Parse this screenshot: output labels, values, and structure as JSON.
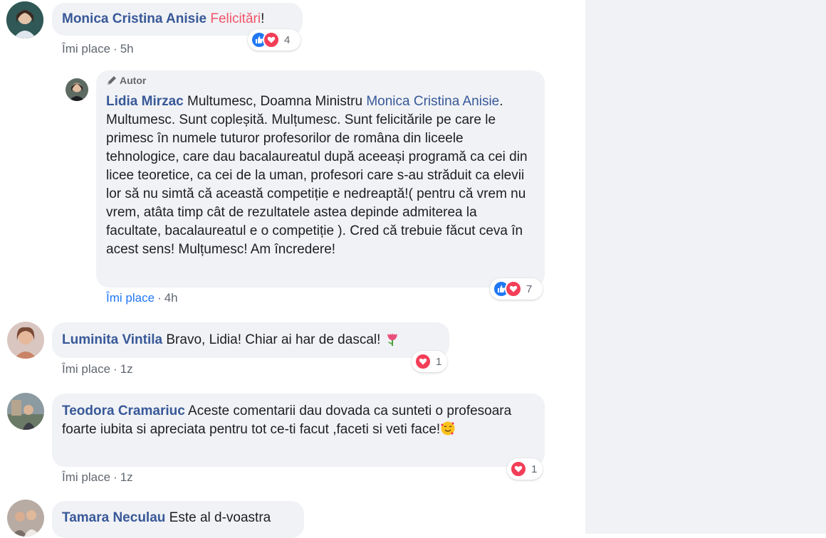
{
  "comments": [
    {
      "name": "Monica Cristina Anisie",
      "text_highlight": "Felicitări",
      "text_suffix": "!",
      "like_label": "Îmi place",
      "time": "5h",
      "reaction_count": "4"
    },
    {
      "badge": "Autor",
      "name": "Lidia Mirzac",
      "text_prefix": " Multumesc, Doamna Ministru ",
      "mention": "Monica Cristina Anisie",
      "text_body": ". Multumesc. Sunt copleșită. Mulțumesc. Sunt felicitările pe care le primesc în numele tuturor profesorilor de româna din liceele tehnologice, care dau bacalaureatul după aceeași programă ca cei din licee teoretice, ca cei de la uman, profesori care s-au străduit ca elevii lor să nu simtă că această competiție e nedreaptă!( pentru că vrem nu vrem, atâta timp cât de rezultatele astea depinde admiterea la facultate, bacalaureatul e o competiție ). Cred că trebuie făcut ceva în acest sens! Mulțumesc! Am încredere!",
      "like_label": "Îmi place",
      "time": "4h",
      "reaction_count": "7"
    },
    {
      "name": "Luminita Vintila",
      "text": " Bravo, Lidia! Chiar ai har de dascal! ",
      "like_label": "Îmi place",
      "time": "1z",
      "reaction_count": "1"
    },
    {
      "name": "Teodora Cramariuc",
      "text": " Aceste comentarii dau dovada ca sunteti o profesoara foarte iubita si apreciata pentru tot ce-ti facut ,faceti si veti face!",
      "like_label": "Îmi place",
      "time": "1z",
      "reaction_count": "1"
    },
    {
      "name": "Tamara Neculau",
      "text": " Este al d-voastra"
    }
  ],
  "separator": "·",
  "colors": {
    "name": "#385898",
    "like_blue": "#2078f4",
    "bubble": "#f0f2f5",
    "panel": "#f0f2f5",
    "love": "#f33e58"
  },
  "icons": [
    "like-icon",
    "love-icon",
    "pencil-icon",
    "tulip-emoji",
    "hug-emoji"
  ]
}
